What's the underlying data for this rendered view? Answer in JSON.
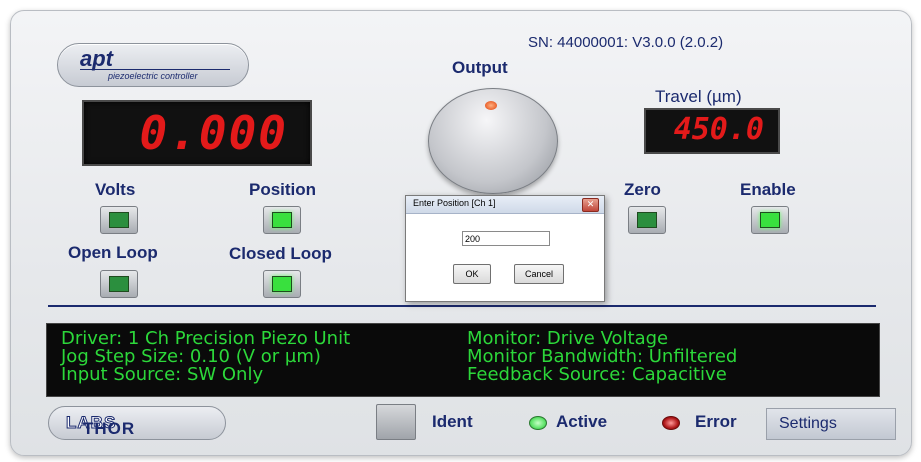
{
  "app": {
    "logo": {
      "brand": "apt",
      "subtitle": "piezoelectric controller"
    },
    "serial": "SN: 44000001: V3.0.0 (2.0.2)"
  },
  "output": {
    "label": "Output",
    "display": "0.000"
  },
  "travel": {
    "label": "Travel (µm)",
    "display": "450.0"
  },
  "buttons": {
    "volts": "Volts",
    "position": "Position",
    "open_loop": "Open Loop",
    "closed_loop": "Closed Loop",
    "zero": "Zero",
    "enable": "Enable"
  },
  "led_states": {
    "volts": "off",
    "position": "on",
    "open_loop": "off",
    "closed_loop": "on",
    "zero": "off",
    "enable": "on"
  },
  "info": {
    "left": [
      "Driver: 1 Ch Precision Piezo Unit",
      "Jog Step Size: 0.10 (V or µm)",
      "Input Source: SW Only"
    ],
    "right": [
      "Monitor: Drive Voltage",
      "Monitor Bandwidth: Unfiltered",
      "Feedback Source: Capacitive"
    ]
  },
  "footer": {
    "brand_left": "THOR",
    "brand_right": "LABS",
    "ident": "Ident",
    "active": "Active",
    "error": "Error",
    "settings": "Settings"
  },
  "dialog": {
    "title": "Enter Position [Ch 1]",
    "value": "200",
    "ok": "OK",
    "cancel": "Cancel"
  },
  "colors": {
    "text": "#1b2a6e",
    "led_red": "#e31a1a",
    "lcd_green": "#2cd83a",
    "active_led": "#5fe36a",
    "error_led": "#b0181a"
  }
}
